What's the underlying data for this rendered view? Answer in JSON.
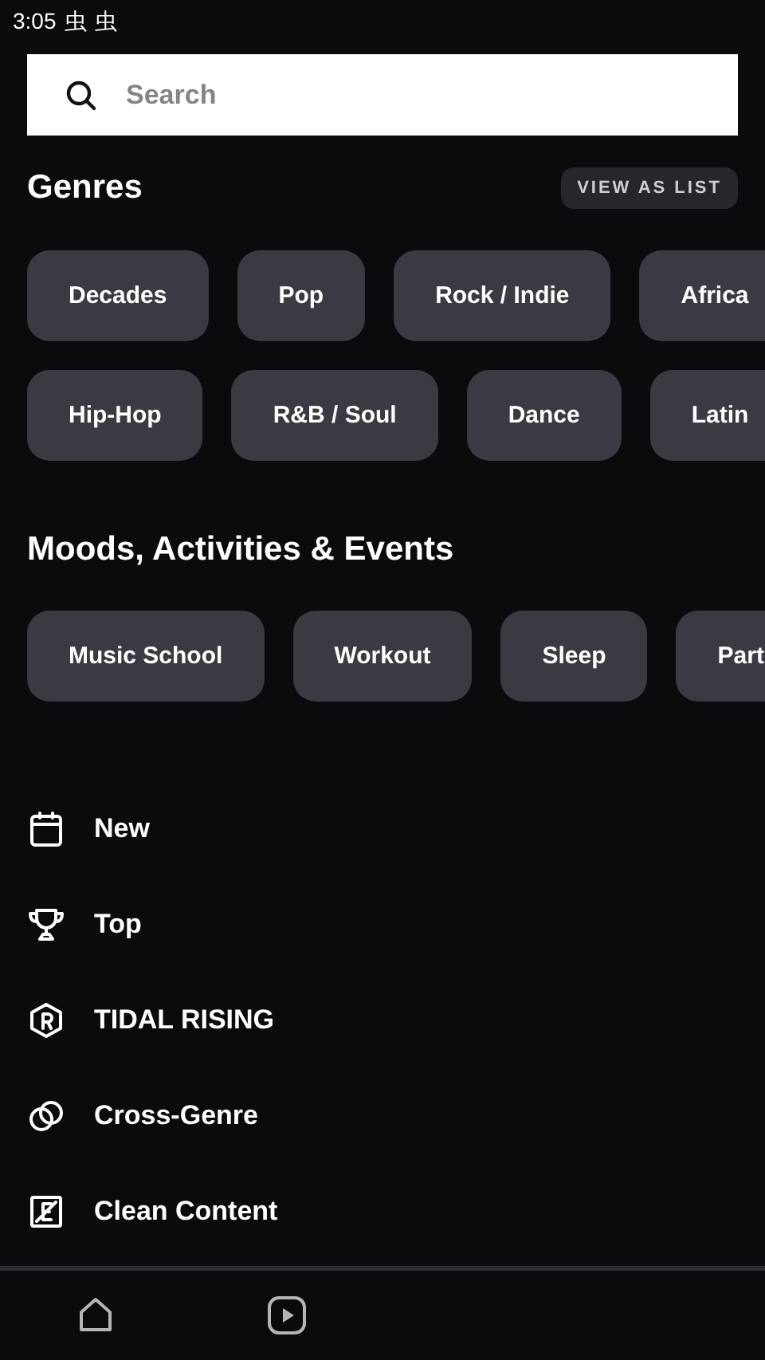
{
  "status_bar": {
    "time": "3:05",
    "icons": [
      "虫",
      "虫"
    ]
  },
  "search": {
    "placeholder": "Search"
  },
  "genres": {
    "title": "Genres",
    "action": "VIEW AS LIST",
    "rows": [
      [
        "Decades",
        "Pop",
        "Rock / Indie",
        "Africa"
      ],
      [
        "Hip-Hop",
        "R&B / Soul",
        "Dance",
        "Latin"
      ]
    ]
  },
  "moods": {
    "title": "Moods, Activities & Events",
    "rows": [
      [
        "Music School",
        "Workout",
        "Sleep",
        "Part"
      ]
    ]
  },
  "links": [
    {
      "kind": "calendar",
      "label": "New"
    },
    {
      "kind": "trophy",
      "label": "Top"
    },
    {
      "kind": "rising",
      "label": "TIDAL RISING"
    },
    {
      "kind": "rings",
      "label": "Cross-Genre"
    },
    {
      "kind": "clean",
      "label": "Clean Content"
    }
  ],
  "nav": [
    {
      "kind": "home"
    },
    {
      "kind": "video"
    }
  ]
}
